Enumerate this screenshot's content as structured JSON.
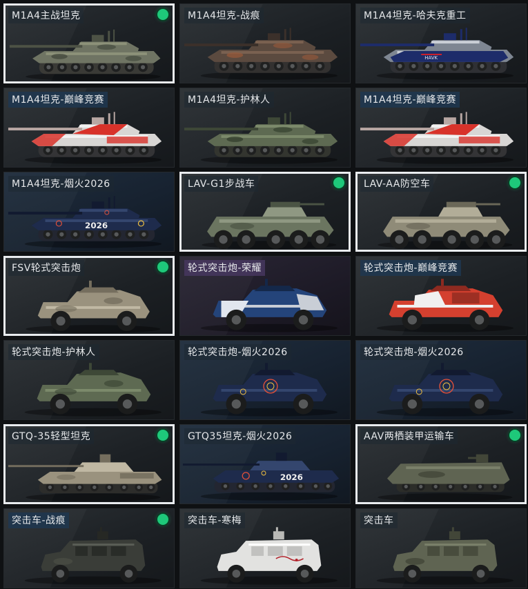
{
  "colors": {
    "equipped_dot": "#1ec87a",
    "selected_border": "#e9ecef"
  },
  "cards": [
    {
      "label": "M1A4主战坦克",
      "kind": "tank",
      "paint": "camo",
      "equipped": true,
      "selected": true,
      "tag": "plain",
      "bg": "plain"
    },
    {
      "label": "M1A4坦克-战痕",
      "kind": "tank",
      "paint": "rust",
      "equipped": false,
      "selected": false,
      "tag": "plain",
      "bg": "plain"
    },
    {
      "label": "M1A4坦克-哈夫克重工",
      "kind": "tank",
      "paint": "hafk",
      "equipped": false,
      "selected": false,
      "tag": "plain",
      "bg": "plain"
    },
    {
      "label": "M1A4坦克-巅峰竞赛",
      "kind": "tank",
      "paint": "race",
      "equipped": false,
      "selected": false,
      "tag": "blue",
      "bg": "plain"
    },
    {
      "label": "M1A4坦克-护林人",
      "kind": "tank",
      "paint": "forest",
      "equipped": false,
      "selected": false,
      "tag": "plain",
      "bg": "plain"
    },
    {
      "label": "M1A4坦克-巅峰竞赛",
      "kind": "tank",
      "paint": "race",
      "equipped": false,
      "selected": false,
      "tag": "blue",
      "bg": "plain"
    },
    {
      "label": "M1A4坦克-烟火2026",
      "kind": "tank",
      "paint": "fireworks",
      "equipped": false,
      "selected": false,
      "tag": "plain",
      "bg": "blue"
    },
    {
      "label": "LAV-G1步战车",
      "kind": "ifv",
      "paint": "green",
      "equipped": true,
      "selected": true,
      "tag": "plain",
      "bg": "plain"
    },
    {
      "label": "LAV-AA防空车",
      "kind": "ifv",
      "paint": "tan",
      "equipped": true,
      "selected": true,
      "tag": "plain",
      "bg": "plain"
    },
    {
      "label": "FSV轮式突击炮",
      "kind": "fsv",
      "paint": "desert",
      "equipped": true,
      "selected": true,
      "tag": "plain",
      "bg": "plain"
    },
    {
      "label": "轮式突击炮-荣耀",
      "kind": "fsv",
      "paint": "glory",
      "equipped": false,
      "selected": false,
      "tag": "purple",
      "bg": "purple"
    },
    {
      "label": "轮式突击炮-巅峰竞赛",
      "kind": "fsv",
      "paint": "racered",
      "equipped": false,
      "selected": false,
      "tag": "blue",
      "bg": "plain"
    },
    {
      "label": "轮式突击炮-护林人",
      "kind": "fsv",
      "paint": "forest",
      "equipped": false,
      "selected": false,
      "tag": "plain",
      "bg": "plain"
    },
    {
      "label": "轮式突击炮-烟火2026",
      "kind": "fsv",
      "paint": "fireworks",
      "equipped": false,
      "selected": false,
      "tag": "plain",
      "bg": "blue"
    },
    {
      "label": "轮式突击炮-烟火2026",
      "kind": "fsv",
      "paint": "fireworks",
      "equipped": false,
      "selected": false,
      "tag": "plain",
      "bg": "blue"
    },
    {
      "label": "GTQ-35轻型坦克",
      "kind": "light",
      "paint": "desert",
      "equipped": true,
      "selected": true,
      "tag": "plain",
      "bg": "plain"
    },
    {
      "label": "GTQ35坦克-烟火2026",
      "kind": "light",
      "paint": "fireworks",
      "equipped": false,
      "selected": false,
      "tag": "plain",
      "bg": "blue"
    },
    {
      "label": "AAV两栖装甲运输车",
      "kind": "aav",
      "paint": "olive",
      "equipped": true,
      "selected": true,
      "tag": "plain",
      "bg": "plain"
    },
    {
      "label": "突击车-战痕",
      "kind": "mrap",
      "paint": "dark",
      "equipped": true,
      "selected": false,
      "tag": "blue",
      "bg": "plain"
    },
    {
      "label": "突击车-寒梅",
      "kind": "mrap",
      "paint": "white",
      "equipped": false,
      "selected": false,
      "tag": "plain",
      "bg": "plain"
    },
    {
      "label": "突击车",
      "kind": "mrap",
      "paint": "olive",
      "equipped": false,
      "selected": false,
      "tag": "plain",
      "bg": "plain"
    }
  ],
  "decals": {
    "fireworks_number": "2026",
    "hafk_text": "HAVK"
  }
}
